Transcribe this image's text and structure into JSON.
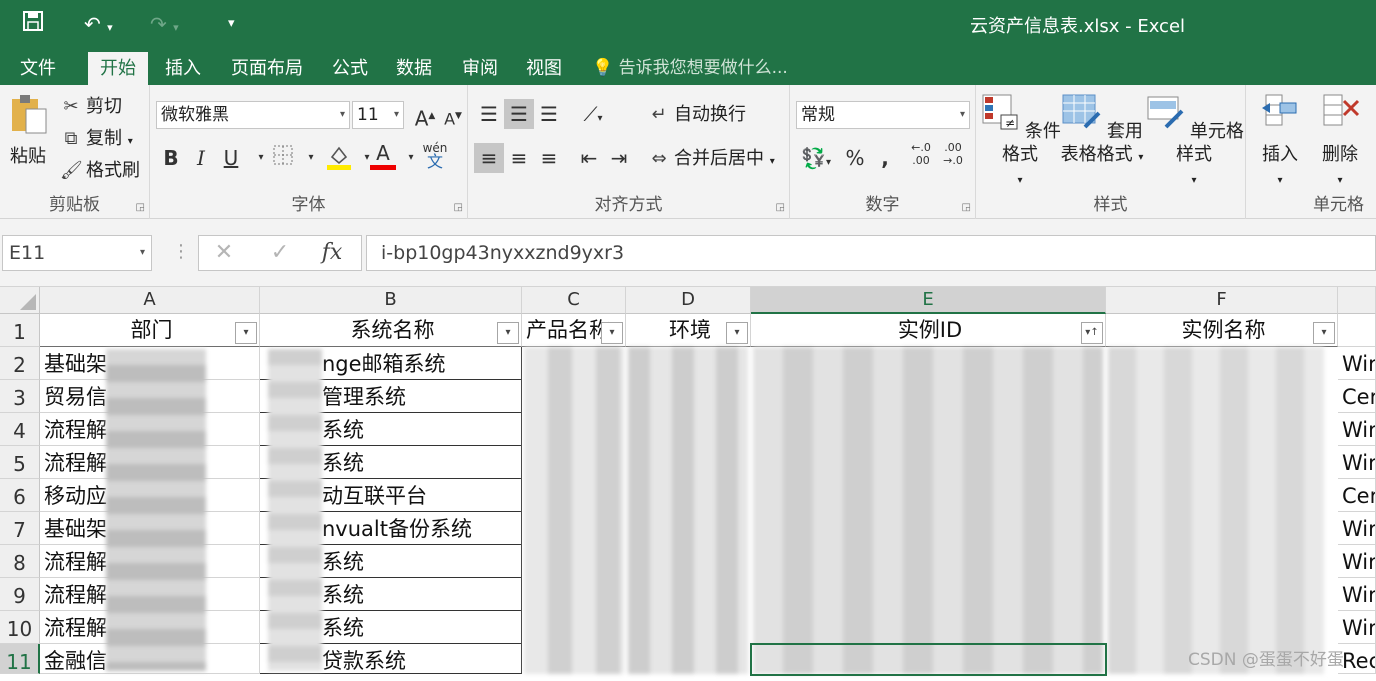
{
  "window": {
    "title": "云资产信息表.xlsx - Excel"
  },
  "quick_access": {
    "save_icon": "save-icon",
    "undo_icon": "undo-icon",
    "redo_icon": "redo-icon",
    "customize_icon": "customize-icon"
  },
  "tabs": [
    {
      "label": "文件"
    },
    {
      "label": "开始"
    },
    {
      "label": "插入"
    },
    {
      "label": "页面布局"
    },
    {
      "label": "公式"
    },
    {
      "label": "数据"
    },
    {
      "label": "审阅"
    },
    {
      "label": "视图"
    }
  ],
  "active_tab": "开始",
  "tell_me": "告诉我您想要做什么...",
  "ribbon": {
    "clipboard": {
      "label": "剪贴板",
      "paste": "粘贴",
      "cut": "剪切",
      "copy": "复制",
      "format_painter": "格式刷"
    },
    "font": {
      "label": "字体",
      "font_name": "微软雅黑",
      "font_size": "11",
      "bold": "B",
      "italic": "I",
      "underline": "U",
      "font_color": "A",
      "phonetic": "wén"
    },
    "alignment": {
      "label": "对齐方式",
      "wrap_text": "自动换行",
      "merge_center": "合并后居中"
    },
    "number": {
      "label": "数字",
      "format": "常规",
      "percent": "%",
      "comma": ","
    },
    "styles": {
      "label": "样式",
      "conditional": "条件格式",
      "table_format_1": "套用",
      "table_format_2": "表格格式",
      "cell_styles": "单元格样式"
    },
    "cells": {
      "label": "单元格",
      "insert": "插入",
      "delete": "删除"
    }
  },
  "formula_bar": {
    "name_box": "E11",
    "fx": "fx",
    "value": "i-bp10gp43nyxxznd9yxr3"
  },
  "columns": [
    "A",
    "B",
    "C",
    "D",
    "E",
    "F"
  ],
  "selected_column": "E",
  "rows": [
    "1",
    "2",
    "3",
    "4",
    "5",
    "6",
    "7",
    "8",
    "9",
    "10",
    "11"
  ],
  "selected_row": "11",
  "headers": {
    "A": "部门",
    "B": "系统名称",
    "C": "产品名称",
    "D": "环境",
    "E": "实例ID",
    "F": "实例名称"
  },
  "cells": {
    "A": [
      "基础架",
      "贸易信",
      "流程解",
      "流程解",
      "移动应",
      "基础架",
      "流程解",
      "流程解",
      "流程解",
      "金融信"
    ],
    "B": [
      "nge邮箱系统",
      "管理系统",
      "系统",
      "系统",
      "动互联平台",
      "nvualt备份系统",
      "系统",
      "系统",
      "系统",
      "贷款系统"
    ],
    "G": [
      "Wir",
      "Cer",
      "Wir",
      "Wir",
      "Cer",
      "Wir",
      "Wir",
      "Wir",
      "Wir",
      "Rec"
    ]
  },
  "watermark": "CSDN @蛋蛋不好蛋"
}
